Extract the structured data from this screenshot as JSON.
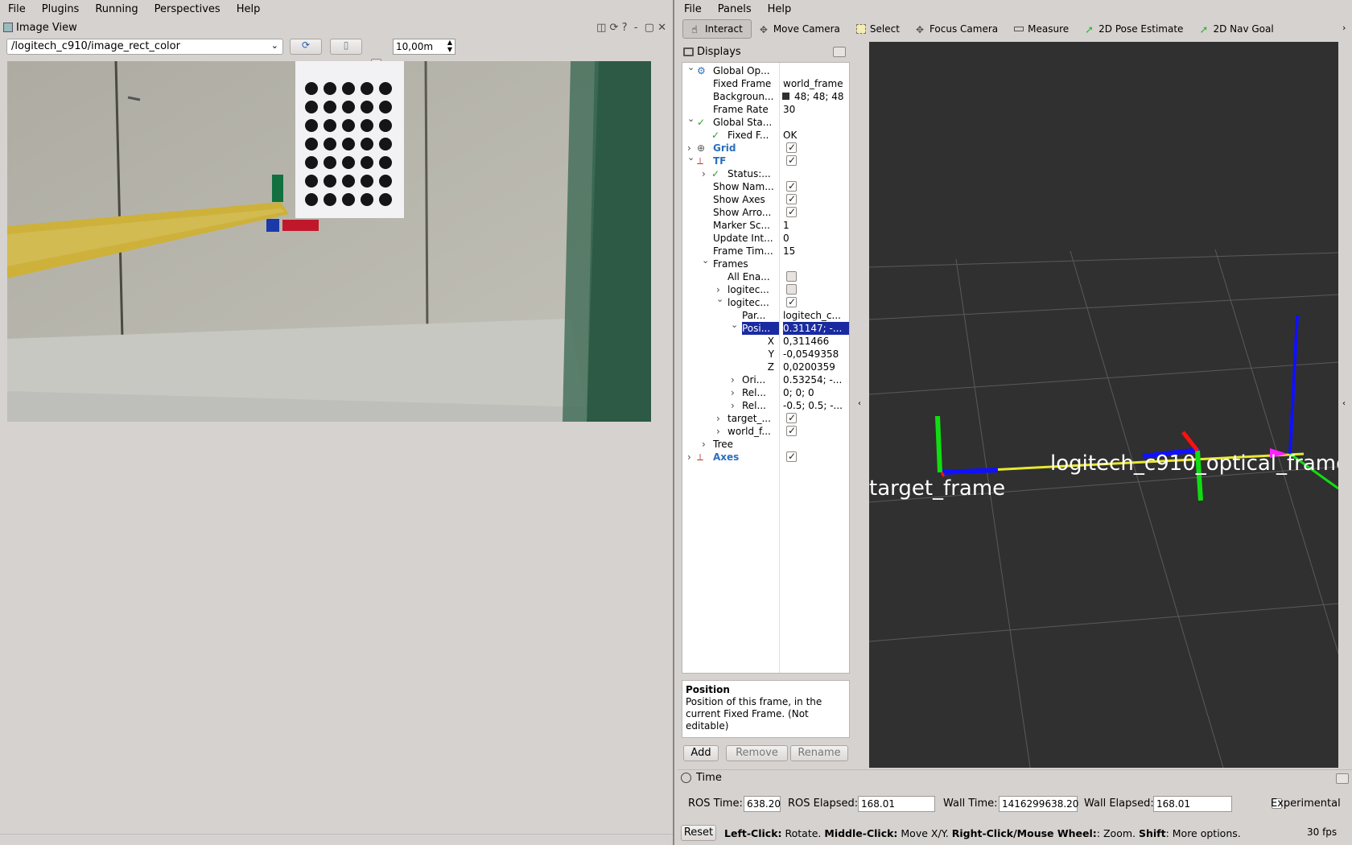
{
  "left_menu": [
    "File",
    "Plugins",
    "Running",
    "Perspectives",
    "Help"
  ],
  "image_view": {
    "title": "Image View",
    "topic": "/logitech_c910/image_rect_color",
    "distance": "10,00m"
  },
  "right_menu": [
    "File",
    "Panels",
    "Help"
  ],
  "toolbar": [
    {
      "label": "Interact",
      "icon": "hand-icon"
    },
    {
      "label": "Move Camera",
      "icon": "move-icon"
    },
    {
      "label": "Select",
      "icon": "select-icon"
    },
    {
      "label": "Focus Camera",
      "icon": "focus-icon"
    },
    {
      "label": "Measure",
      "icon": "ruler-icon"
    },
    {
      "label": "2D Pose Estimate",
      "icon": "arrow-green-icon"
    },
    {
      "label": "2D Nav Goal",
      "icon": "arrow-green-icon"
    }
  ],
  "displays": {
    "title": "Displays",
    "rows": [
      {
        "name": "Global Op...",
        "value": "",
        "indent": 0,
        "arrow": "v",
        "icon": "gear-icon",
        "style": ""
      },
      {
        "name": "Fixed Frame",
        "value": "world_frame",
        "indent": 1,
        "arrow": "",
        "icon": "",
        "style": ""
      },
      {
        "name": "Backgroun...",
        "value": "48; 48; 48",
        "indent": 1,
        "arrow": "",
        "icon": "",
        "style": "swatch"
      },
      {
        "name": "Frame Rate",
        "value": "30",
        "indent": 1,
        "arrow": "",
        "icon": "",
        "style": ""
      },
      {
        "name": "Global Sta...",
        "value": "",
        "indent": 0,
        "arrow": "v",
        "icon": "tick",
        "style": ""
      },
      {
        "name": "Fixed F...",
        "value": "OK",
        "indent": 1,
        "arrow": "",
        "icon": "tick",
        "style": ""
      },
      {
        "name": "Grid",
        "value": "",
        "indent": 0,
        "arrow": ">",
        "icon": "grid-icon",
        "style": "blue",
        "cb": "on"
      },
      {
        "name": "TF",
        "value": "",
        "indent": 0,
        "arrow": "v",
        "icon": "tf-icon",
        "style": "blue",
        "cb": "on"
      },
      {
        "name": "Status:...",
        "value": "",
        "indent": 1,
        "arrow": ">",
        "icon": "tick",
        "style": ""
      },
      {
        "name": "Show Nam...",
        "value": "",
        "indent": 1,
        "arrow": "",
        "icon": "",
        "style": "",
        "cb": "on"
      },
      {
        "name": "Show Axes",
        "value": "",
        "indent": 1,
        "arrow": "",
        "icon": "",
        "style": "",
        "cb": "on"
      },
      {
        "name": "Show Arro...",
        "value": "",
        "indent": 1,
        "arrow": "",
        "icon": "",
        "style": "",
        "cb": "on"
      },
      {
        "name": "Marker Sc...",
        "value": "1",
        "indent": 1,
        "arrow": "",
        "icon": "",
        "style": ""
      },
      {
        "name": "Update Int...",
        "value": "0",
        "indent": 1,
        "arrow": "",
        "icon": "",
        "style": ""
      },
      {
        "name": "Frame Tim...",
        "value": "15",
        "indent": 1,
        "arrow": "",
        "icon": "",
        "style": ""
      },
      {
        "name": "Frames",
        "value": "",
        "indent": 1,
        "arrow": "v",
        "icon": "",
        "style": ""
      },
      {
        "name": "All Ena...",
        "value": "",
        "indent": 2,
        "arrow": "",
        "icon": "",
        "style": "",
        "cb": "dis"
      },
      {
        "name": "logitec...",
        "value": "",
        "indent": 2,
        "arrow": ">",
        "icon": "",
        "style": "",
        "cb": "dis"
      },
      {
        "name": "logitec...",
        "value": "",
        "indent": 2,
        "arrow": "v",
        "icon": "",
        "style": "",
        "cb": "on"
      },
      {
        "name": "Par...",
        "value": "logitech_c...",
        "indent": 3,
        "arrow": "",
        "icon": "",
        "style": ""
      },
      {
        "name": "Posi...",
        "value": "0.31147; -...",
        "indent": 3,
        "arrow": "v",
        "icon": "",
        "style": "sel"
      },
      {
        "name": "X",
        "value": "0,311466",
        "indent": 4,
        "arrow": "",
        "icon": "",
        "style": "right"
      },
      {
        "name": "Y",
        "value": "-0,0549358",
        "indent": 4,
        "arrow": "",
        "icon": "",
        "style": "right"
      },
      {
        "name": "Z",
        "value": "0,0200359",
        "indent": 4,
        "arrow": "",
        "icon": "",
        "style": "right"
      },
      {
        "name": "Ori...",
        "value": "0.53254; -...",
        "indent": 3,
        "arrow": ">",
        "icon": "",
        "style": ""
      },
      {
        "name": "Rel...",
        "value": "0; 0; 0",
        "indent": 3,
        "arrow": ">",
        "icon": "",
        "style": ""
      },
      {
        "name": "Rel...",
        "value": "-0.5; 0.5; -...",
        "indent": 3,
        "arrow": ">",
        "icon": "",
        "style": ""
      },
      {
        "name": "target_...",
        "value": "",
        "indent": 2,
        "arrow": ">",
        "icon": "",
        "style": "",
        "cb": "on"
      },
      {
        "name": "world_f...",
        "value": "",
        "indent": 2,
        "arrow": ">",
        "icon": "",
        "style": "",
        "cb": "on"
      },
      {
        "name": "Tree",
        "value": "",
        "indent": 1,
        "arrow": ">",
        "icon": "",
        "style": ""
      },
      {
        "name": "Axes",
        "value": "",
        "indent": 0,
        "arrow": ">",
        "icon": "axes-icon",
        "style": "blue",
        "cb": "on"
      }
    ],
    "help_title": "Position",
    "help_text": "Position of this frame, in the current Fixed Frame. (Not editable)",
    "add": "Add",
    "remove": "Remove",
    "rename": "Rename"
  },
  "viewport": {
    "label_target": "target_frame",
    "label_camera": "logitech_c910_optical_frame",
    "bg": "#303030"
  },
  "time": {
    "title": "Time",
    "ros_time_label": "ROS Time:",
    "ros_time": "638.20",
    "ros_elapsed_label": "ROS Elapsed:",
    "ros_elapsed": "168.01",
    "wall_time_label": "Wall Time:",
    "wall_time": "1416299638.20",
    "wall_elapsed_label": "Wall Elapsed:",
    "wall_elapsed": "168.01",
    "experimental": "Experimental"
  },
  "status": {
    "reset": "Reset",
    "hint_b1": "Left-Click:",
    "hint_t1": " Rotate. ",
    "hint_b2": "Middle-Click:",
    "hint_t2": " Move X/Y. ",
    "hint_b3": "Right-Click/Mouse Wheel:",
    "hint_t3": ": Zoom. ",
    "hint_b4": "Shift",
    "hint_t4": ": More options.",
    "fps": "30 fps"
  }
}
